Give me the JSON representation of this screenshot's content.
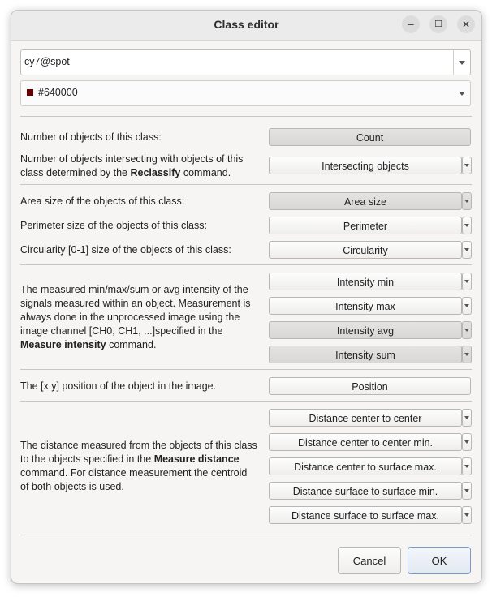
{
  "window": {
    "title": "Class editor",
    "minimize": "–",
    "maximize": "☐",
    "close": "✕"
  },
  "class_name": "cy7@spot",
  "color": {
    "label": "#640000",
    "value": "#640000"
  },
  "sections": {
    "count": {
      "label": "Number of objects of this class:",
      "button": "Count"
    },
    "intersecting": {
      "line1": "Number of objects intersecting with objects of this",
      "line2_pre": "class determined by the ",
      "line2_bold": "Reclassify",
      "line2_post": " command.",
      "button": "Intersecting objects"
    },
    "area": {
      "label": "Area size of the objects of this class:",
      "button": "Area size"
    },
    "perimeter": {
      "label": "Perimeter size of the objects of this class:",
      "button": "Perimeter"
    },
    "circularity": {
      "label": "Circularity [0-1] size of the objects of this class:",
      "button": "Circularity"
    },
    "intensity": {
      "line1": "The measured min/max/sum or avg intensity of the",
      "line2": "signals measured within an object. Measurement is",
      "line3": "always done in the unprocessed image using the",
      "line4": "image channel [CH0, CH1, ...]specified in the",
      "line5_bold": "Measure intensity",
      "line5_post": " command.",
      "buttons": [
        "Intensity min",
        "Intensity max",
        "Intensity avg",
        "Intensity sum"
      ]
    },
    "position": {
      "label": "The [x,y] position of the object in the image.",
      "button": "Position"
    },
    "distance": {
      "line1": "The distance measured from the objects of this class",
      "line2_pre": "to the objects specified in the ",
      "line2_bold": "Measure distance",
      "line3": "command. For distance measurement the centroid",
      "line4": "of both objects is used.",
      "buttons": [
        "Distance center to center",
        "Distance center to center min.",
        "Distance center to surface max.",
        "Distance surface to surface min.",
        "Distance surface to surface max."
      ]
    }
  },
  "footer": {
    "cancel": "Cancel",
    "ok": "OK"
  }
}
